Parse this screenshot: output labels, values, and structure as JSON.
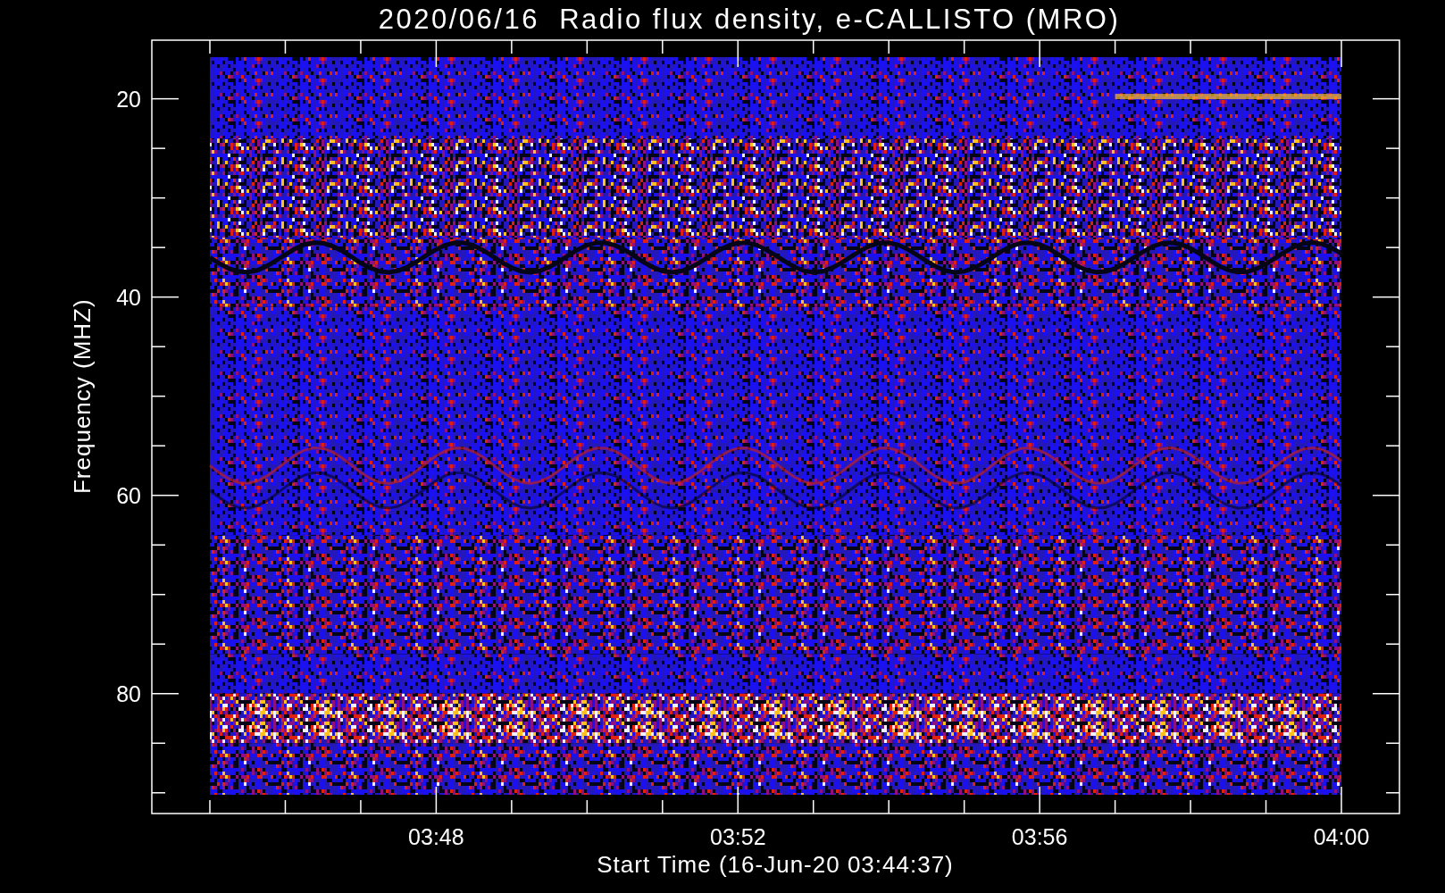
{
  "title": "2020/06/16  Radio flux density, e-CALLISTO (MRO)",
  "y_axis": {
    "label": "Frequency (MHZ)",
    "ticks": [
      "20",
      "40",
      "60",
      "80"
    ]
  },
  "x_axis": {
    "label": "Start Time (16-Jun-20 03:44:37)",
    "ticks": [
      "03:48",
      "03:52",
      "03:56",
      "04:00"
    ]
  }
}
